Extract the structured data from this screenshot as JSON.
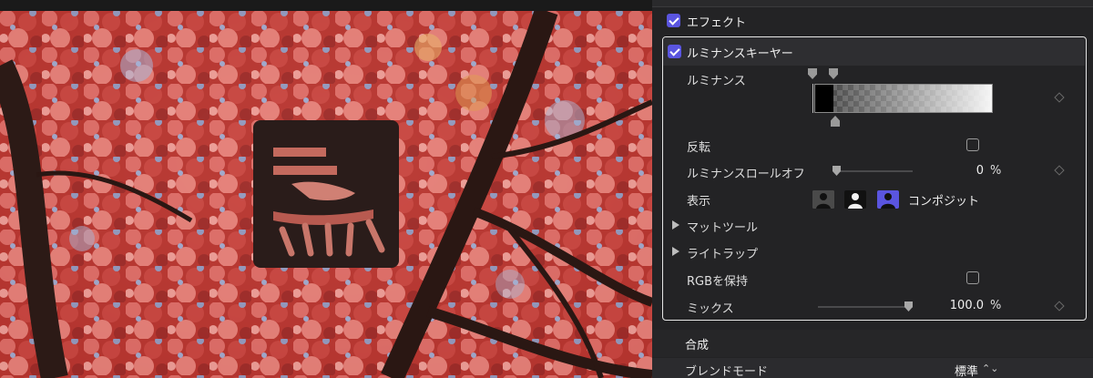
{
  "effects": {
    "label": "エフェクト",
    "enabled": true
  },
  "keyer": {
    "title": "ルミナンスキーヤー",
    "enabled": true,
    "luminance_label": "ルミナンス",
    "invert_label": "反転",
    "invert_checked": false,
    "rolloff_label": "ルミナンスロールオフ",
    "rolloff_value": "0",
    "rolloff_unit": "%",
    "view_label": "表示",
    "view_options": [
      "マット",
      "オリジナル",
      "コンポジット"
    ],
    "view_selected": "コンポジット",
    "matte_tools_label": "マットツール",
    "light_wrap_label": "ライトラップ",
    "preserve_rgb_label": "RGBを保持",
    "preserve_rgb_checked": false,
    "mix_label": "ミックス",
    "mix_value": "100.0",
    "mix_unit": "%"
  },
  "compositing": {
    "title": "合成",
    "blend_mode_label": "ブレンドモード",
    "blend_mode_value": "標準",
    "blend_chevron": "⌃⌄"
  },
  "colors": {
    "accent": "#5a55e0",
    "panel_bg": "#232325",
    "foliage_red": "#c8413c",
    "logo_fill": "#2a1c1a"
  },
  "icons": [
    "checkbox-icon",
    "keyframe-diamond-icon",
    "disclosure-triangle-icon",
    "person-silhouette-icon",
    "chevron-updown-icon"
  ]
}
